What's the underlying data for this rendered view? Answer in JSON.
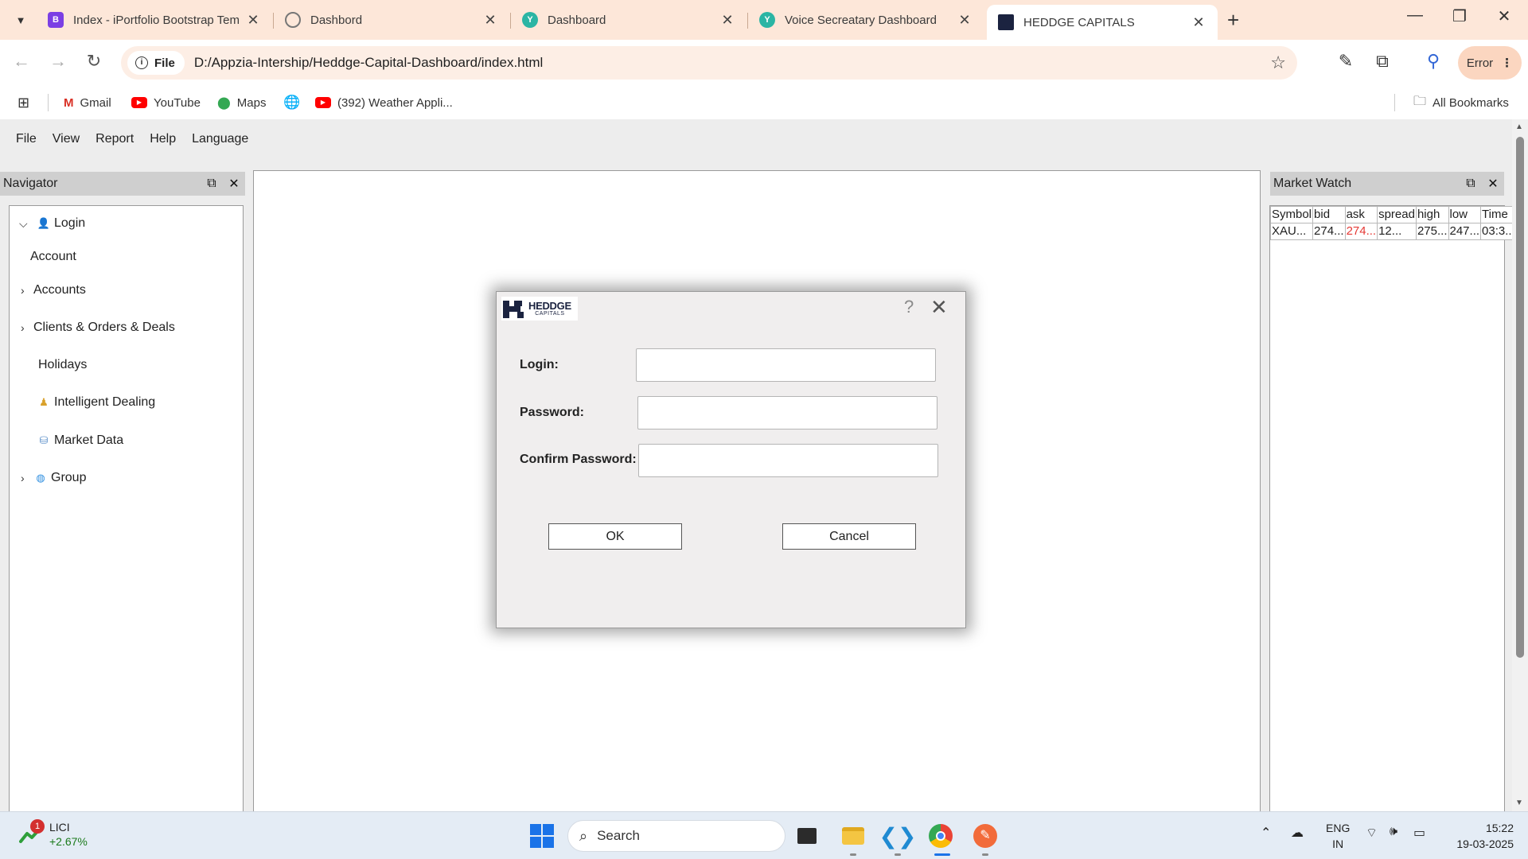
{
  "browser": {
    "tabs": [
      {
        "title": "Index - iPortfolio Bootstrap Template",
        "favicon": "B",
        "color": "#7b3fe4"
      },
      {
        "title": "Dashbord",
        "favicon": "globe",
        "color": "#777777"
      },
      {
        "title": "Dashboard",
        "favicon": "Y",
        "color": "#2bb5a4"
      },
      {
        "title": "Voice Secreatary Dashboard",
        "favicon": "Y",
        "color": "#2bb5a4"
      },
      {
        "title": "HEDDGE CAPITALS",
        "favicon": "logo",
        "color": "#1b2340"
      }
    ],
    "site_chip": "File",
    "url": "D:/Appzia-Intership/Heddge-Capital-Dashboard/index.html",
    "profile_button": "Error",
    "bookmarks": [
      "Gmail",
      "YouTube",
      "Maps",
      "(392) Weather Appli..."
    ],
    "all_bookmarks": "All Bookmarks"
  },
  "menu": [
    "File",
    "View",
    "Report",
    "Help",
    "Language"
  ],
  "navigator": {
    "title": "Navigator",
    "items": [
      {
        "label": "Login",
        "chevron": "down",
        "icon": "user-icon"
      },
      {
        "label": "Account",
        "chevron": "",
        "icon": ""
      },
      {
        "label": "Accounts",
        "chevron": "right",
        "icon": ""
      },
      {
        "label": "Clients & Orders & Deals",
        "chevron": "right",
        "icon": ""
      },
      {
        "label": "Holidays",
        "chevron": "",
        "icon": ""
      },
      {
        "label": "Intelligent Dealing",
        "chevron": "",
        "icon": "dealer-icon"
      },
      {
        "label": "Market Data",
        "chevron": "",
        "icon": "database-icon"
      },
      {
        "label": "Group",
        "chevron": "right",
        "icon": "group-icon"
      }
    ]
  },
  "market_watch": {
    "title": "Market Watch",
    "headers": [
      "Symbol",
      "bid",
      "ask",
      "spread",
      "high",
      "low",
      "Time"
    ],
    "rows": [
      [
        "XAU...",
        "274...",
        "274...",
        "12...",
        "275...",
        "247...",
        "03:3..."
      ]
    ],
    "ask_color": "#e53935"
  },
  "dialog": {
    "logo_main": "HEDDGE",
    "logo_sub": "CAPITALS",
    "help": "?",
    "fields": [
      {
        "label": "Login:",
        "value": ""
      },
      {
        "label": "Password:",
        "value": ""
      },
      {
        "label": "Confirm Password:",
        "value": ""
      }
    ],
    "ok": "OK",
    "cancel": "Cancel"
  },
  "taskbar": {
    "stock_name": "LICI",
    "stock_change": "+2.67%",
    "badge": "1",
    "search": "Search",
    "lang1": "ENG",
    "lang2": "IN",
    "time": "15:22",
    "date": "19-03-2025"
  }
}
